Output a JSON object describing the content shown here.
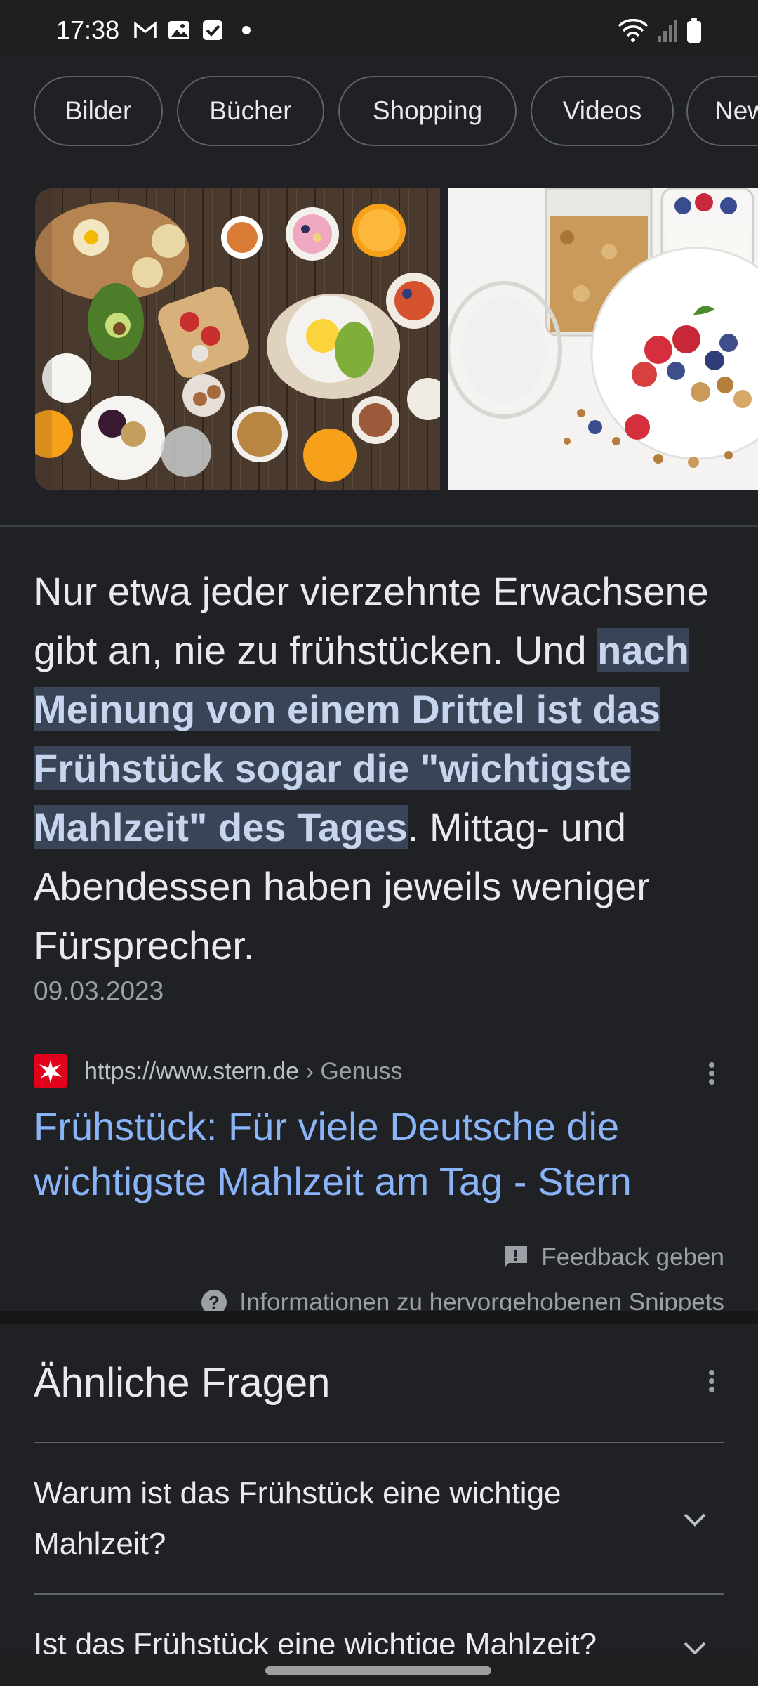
{
  "status_bar": {
    "time": "17:38",
    "left_icons": [
      "gmail-icon",
      "gallery-icon",
      "tasks-icon",
      "dot-icon"
    ],
    "right_icons": [
      "wifi-icon",
      "signal-icon",
      "battery-icon"
    ]
  },
  "chips": [
    "Bilder",
    "Bücher",
    "Shopping",
    "Videos",
    "New"
  ],
  "snippet": {
    "text_before": "Nur etwa jeder vierzehnte Erwachsene gibt an, nie zu frühstücken. Und ",
    "text_highlight": "nach Meinung von einem Drittel ist das Frühstück sogar die \"wichtigste Mahlzeit\" des Tages",
    "text_after": ". Mittag- und Abendessen haben jeweils weniger Fürsprecher.",
    "date": "09.03.2023"
  },
  "source": {
    "url": "https://www.stern.de",
    "breadcrumb": " › Genuss",
    "title": "Frühstück: Für viele Deutsche die wichtigste Mahlzeit am Tag - Stern"
  },
  "feedback_label": "Feedback geben",
  "info_label": "Informationen zu hervorgehobenen Snippets",
  "faq": {
    "title": "Ähnliche Fragen",
    "questions": [
      "Warum ist das Frühstück eine wichtige Mahlzeit?",
      "Ist das Frühstück eine wichtige Mahlzeit?"
    ]
  },
  "colors": {
    "background": "#202124",
    "link": "#8ab4f8",
    "highlight_bg": "#394457",
    "stern_red": "#e2001a"
  }
}
